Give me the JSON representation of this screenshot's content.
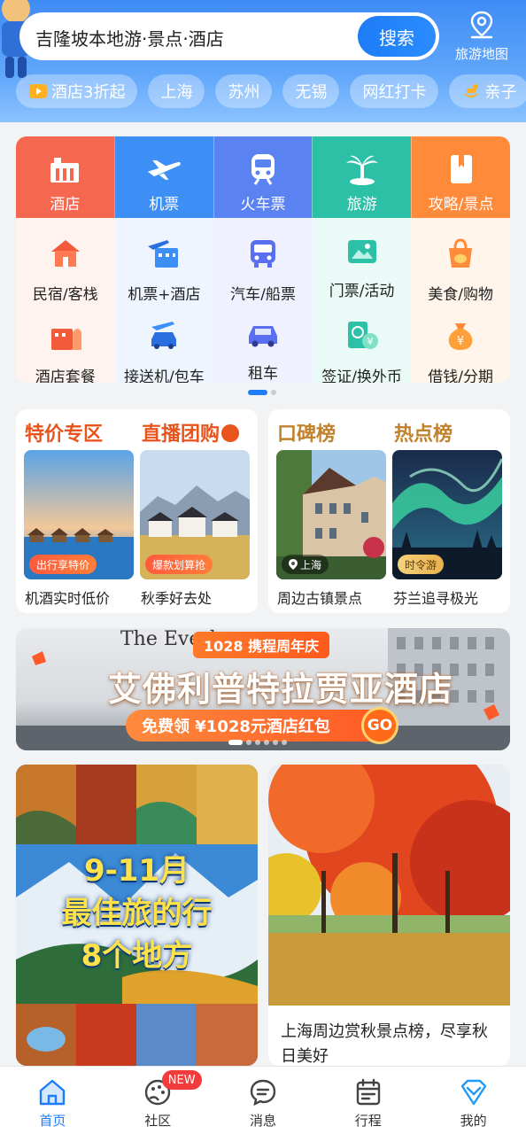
{
  "search": {
    "text": "吉隆坡本地游·景点·酒店",
    "button": "搜索",
    "map_label": "旅游地图"
  },
  "chips": [
    {
      "label": "酒店3折起",
      "icon": "play-icon"
    },
    {
      "label": "上海"
    },
    {
      "label": "苏州"
    },
    {
      "label": "无锡"
    },
    {
      "label": "网红打卡"
    },
    {
      "label": "亲子",
      "icon": "rocking-horse-icon"
    }
  ],
  "services": {
    "top": [
      {
        "label": "酒店",
        "color": "#f6674f",
        "icon": "hotel-icon"
      },
      {
        "label": "机票",
        "color": "#3d8ef5",
        "icon": "plane-icon"
      },
      {
        "label": "火车票",
        "color": "#5a82f0",
        "icon": "train-icon"
      },
      {
        "label": "旅游",
        "color": "#2cc0a6",
        "icon": "palm-tree-icon"
      },
      {
        "label": "攻略/景点",
        "color": "#ff8a3a",
        "icon": "guidebook-icon"
      }
    ],
    "row2": [
      {
        "label": "民宿/客栈",
        "icon": "house-icon"
      },
      {
        "label": "机票+酒店",
        "icon": "plane-hotel-icon"
      },
      {
        "label": "汽车/船票",
        "icon": "bus-icon"
      },
      {
        "label": "门票/活动",
        "icon": "ticket-icon"
      },
      {
        "label": "美食/购物",
        "icon": "shopping-bag-icon"
      }
    ],
    "row3": [
      {
        "label": "酒店套餐",
        "icon": "hotel-package-icon"
      },
      {
        "label": "接送机/包车",
        "icon": "airport-car-icon"
      },
      {
        "label": "租车",
        "icon": "car-icon"
      },
      {
        "label": "签证/换外币",
        "icon": "visa-icon"
      },
      {
        "label": "借钱/分期",
        "icon": "money-bag-icon"
      }
    ]
  },
  "features": {
    "left": {
      "title1": "特价专区",
      "title2": "直播团购",
      "card1": {
        "tag": "出行享特价",
        "caption": "机酒实时低价"
      },
      "card2": {
        "tag": "爆款划算抢",
        "caption": "秋季好去处"
      }
    },
    "right": {
      "title1": "口碑榜",
      "title2": "热点榜",
      "card1": {
        "tag": "上海",
        "caption": "周边古镇景点"
      },
      "card2": {
        "tag": "时令游",
        "caption": "芬兰追寻极光"
      }
    }
  },
  "banner": {
    "hotel_en": "The Everl",
    "anniversary": "1028 携程周年庆",
    "hotel_name": "艾佛利普特拉贾亚酒店",
    "coupon": "免费领 ¥1028元酒店红包",
    "go": "GO"
  },
  "waterfall": {
    "left_headline": [
      "9-11月",
      "最佳旅的行",
      "8个地方"
    ],
    "right_desc": "上海周边赏秋景点榜，尽享秋日美好"
  },
  "tabbar": [
    {
      "label": "首页",
      "icon": "home-icon",
      "active": true
    },
    {
      "label": "社区",
      "icon": "community-icon",
      "badge": "NEW"
    },
    {
      "label": "消息",
      "icon": "message-icon"
    },
    {
      "label": "行程",
      "icon": "itinerary-icon"
    },
    {
      "label": "我的",
      "icon": "profile-icon"
    }
  ],
  "colors": {
    "accent": "#1e7cf7",
    "header_top": "#3f8cf5",
    "promo_orange": "#e9531c",
    "promo_brown": "#c0822c"
  }
}
